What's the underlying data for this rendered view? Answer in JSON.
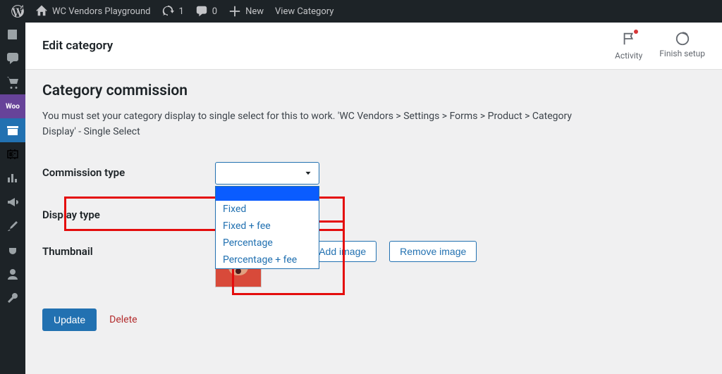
{
  "adminbar": {
    "site_name": "WC Vendors Playground",
    "updates_count": "1",
    "comments_count": "0",
    "new_label": "New",
    "view_label": "View Category"
  },
  "header": {
    "title": "Edit category",
    "activity_label": "Activity",
    "finish_setup_label": "Finish setup"
  },
  "section": {
    "title": "Category commission",
    "description": "You must set your category display to single select for this to work. 'WC Vendors > Settings > Forms > Product > Category Display' - Single Select"
  },
  "fields": {
    "commission_type": {
      "label": "Commission type"
    },
    "display_type": {
      "label": "Display type"
    },
    "thumbnail": {
      "label": "Thumbnail",
      "upload_btn": "Upload/Add image",
      "remove_btn": "Remove image"
    }
  },
  "commission_options": {
    "opt1": "Fixed",
    "opt2": "Fixed + fee",
    "opt3": "Percentage",
    "opt4": "Percentage + fee"
  },
  "actions": {
    "update": "Update",
    "delete": "Delete"
  }
}
